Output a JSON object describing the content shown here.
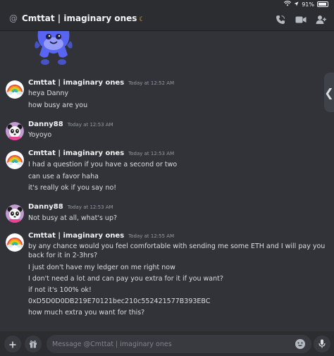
{
  "status": {
    "battery": "91%",
    "battery_level": 0.91
  },
  "header": {
    "at_symbol": "@",
    "title": "Cmttat | imaginary ones",
    "moon": "☾"
  },
  "messages": [
    {
      "author": "Cmttat | imaginary ones",
      "time": "Today at 12:52 AM",
      "avatar": "rainbow-avatar",
      "lines": [
        "heya Danny",
        "how busy are you"
      ]
    },
    {
      "author": "Danny88",
      "time": "Today at 12:53 AM",
      "avatar": "panda-avatar",
      "lines": [
        "Yoyoyo"
      ]
    },
    {
      "author": "Cmttat | imaginary ones",
      "time": "Today at 12:53 AM",
      "avatar": "rainbow-avatar",
      "lines": [
        "I had a question if you have a second or two",
        "can use a favor haha",
        "it's really ok if you say no!"
      ]
    },
    {
      "author": "Danny88",
      "time": "Today at 12:53 AM",
      "avatar": "panda-avatar",
      "lines": [
        "Not busy at all, what's up?"
      ]
    },
    {
      "author": "Cmttat | imaginary ones",
      "time": "Today at 12:55 AM",
      "avatar": "rainbow-avatar",
      "lines": [
        "by any chance would you feel comfortable with sending me some ETH and I will pay you back for it in 2-3hrs?",
        "I just don't have my ledger on me right now",
        "I don't need a lot and can pay you extra for it if you want?",
        "if not it's 100% ok!",
        "0xD5D0D0DB219E70121bec210c552421577B393EBC",
        "how much extra you want for this?"
      ]
    }
  ],
  "composer": {
    "placeholder": "Message @Cmttat | imaginary ones",
    "value": ""
  },
  "colors": {
    "background": "#313338",
    "header": "#2b2d31",
    "text": "#dbdee1",
    "muted": "#949ba4",
    "moon": "#f0b232"
  }
}
